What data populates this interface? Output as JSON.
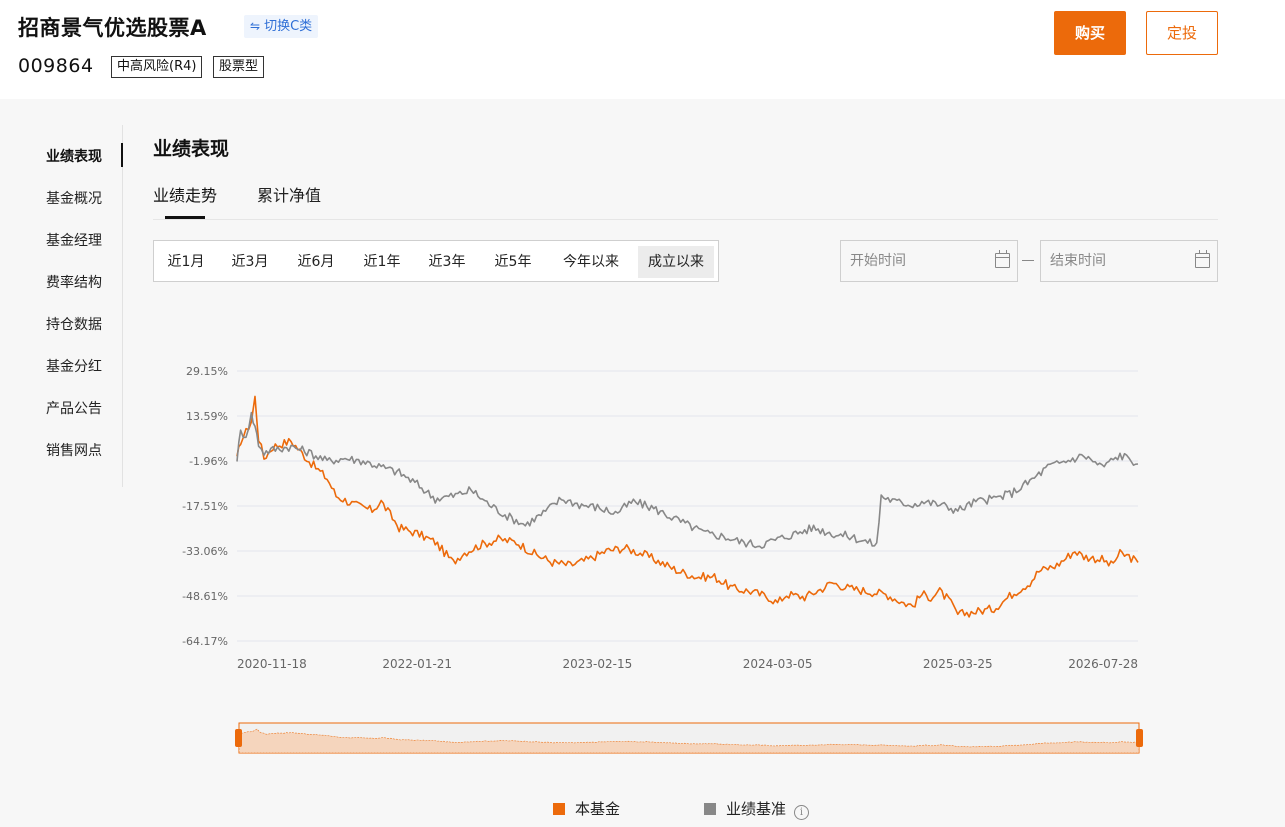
{
  "header": {
    "fund_name": "招商景气优选股票A",
    "switch_label": "切换C类",
    "fund_code": "009864",
    "tags": [
      "中高风险(R4)",
      "股票型"
    ],
    "buy_label": "购买",
    "plan_label": "定投"
  },
  "sidebar": {
    "items": [
      {
        "label": "业绩表现",
        "active": true
      },
      {
        "label": "基金概况"
      },
      {
        "label": "基金经理"
      },
      {
        "label": "费率结构"
      },
      {
        "label": "持仓数据"
      },
      {
        "label": "基金分红"
      },
      {
        "label": "产品公告"
      },
      {
        "label": "销售网点"
      }
    ]
  },
  "main": {
    "section_title": "业绩表现",
    "subtabs": [
      {
        "label": "业绩走势",
        "active": true
      },
      {
        "label": "累计净值"
      }
    ],
    "periods": [
      {
        "label": "近1月"
      },
      {
        "label": "近3月"
      },
      {
        "label": "近6月"
      },
      {
        "label": "近1年"
      },
      {
        "label": "近3年"
      },
      {
        "label": "近5年"
      },
      {
        "label": "今年以来"
      },
      {
        "label": "成立以来",
        "active": true
      }
    ],
    "start_placeholder": "开始时间",
    "end_placeholder": "结束时间"
  },
  "colors": {
    "accent": "#ec6a0b",
    "fund_line": "#ec6a0b",
    "benchmark_line": "#888888",
    "grid": "#e3e6ee"
  },
  "chart_data": {
    "type": "line",
    "y_tick_labels": [
      "29.15%",
      "13.59%",
      "-1.96%",
      "-17.51%",
      "-33.06%",
      "-48.61%",
      "-64.17%"
    ],
    "y_ticks": [
      29.15,
      13.59,
      -1.96,
      -17.51,
      -33.06,
      -48.61,
      -64.17
    ],
    "ylim": [
      -64.17,
      29.15
    ],
    "x_tick_labels": [
      "2020-11-18",
      "2022-01-21",
      "2023-02-15",
      "2024-03-05",
      "2025-03-25",
      "2026-07-28"
    ],
    "x_tick_positions": [
      0,
      0.2,
      0.4,
      0.6,
      0.8,
      1.0
    ],
    "series": [
      {
        "name": "本基金",
        "color": "#ec6a0b",
        "points": [
          [
            0,
            -1.5
          ],
          [
            0.004,
            5
          ],
          [
            0.01,
            8
          ],
          [
            0.016,
            12
          ],
          [
            0.02,
            20
          ],
          [
            0.024,
            6
          ],
          [
            0.03,
            -1
          ],
          [
            0.04,
            3
          ],
          [
            0.06,
            5
          ],
          [
            0.08,
            -2
          ],
          [
            0.1,
            -8
          ],
          [
            0.11,
            -14
          ],
          [
            0.13,
            -17
          ],
          [
            0.15,
            -19
          ],
          [
            0.16,
            -16
          ],
          [
            0.18,
            -25
          ],
          [
            0.2,
            -27
          ],
          [
            0.22,
            -30
          ],
          [
            0.24,
            -37
          ],
          [
            0.25,
            -34
          ],
          [
            0.27,
            -31
          ],
          [
            0.29,
            -29
          ],
          [
            0.31,
            -30
          ],
          [
            0.33,
            -34
          ],
          [
            0.35,
            -37
          ],
          [
            0.37,
            -38
          ],
          [
            0.39,
            -36
          ],
          [
            0.41,
            -33
          ],
          [
            0.43,
            -32
          ],
          [
            0.45,
            -34
          ],
          [
            0.47,
            -37
          ],
          [
            0.49,
            -40
          ],
          [
            0.51,
            -42
          ],
          [
            0.53,
            -42
          ],
          [
            0.55,
            -46
          ],
          [
            0.57,
            -47
          ],
          [
            0.59,
            -49
          ],
          [
            0.6,
            -51
          ],
          [
            0.61,
            -48
          ],
          [
            0.63,
            -49
          ],
          [
            0.65,
            -46
          ],
          [
            0.66,
            -44
          ],
          [
            0.68,
            -46
          ],
          [
            0.7,
            -47
          ],
          [
            0.72,
            -48
          ],
          [
            0.74,
            -51
          ],
          [
            0.75,
            -52
          ],
          [
            0.76,
            -48
          ],
          [
            0.77,
            -49
          ],
          [
            0.78,
            -47
          ],
          [
            0.79,
            -50
          ],
          [
            0.8,
            -55
          ],
          [
            0.82,
            -54
          ],
          [
            0.84,
            -53
          ],
          [
            0.86,
            -48
          ],
          [
            0.88,
            -44
          ],
          [
            0.89,
            -40
          ],
          [
            0.91,
            -38
          ],
          [
            0.93,
            -33
          ],
          [
            0.94,
            -35
          ],
          [
            0.96,
            -36
          ],
          [
            0.97,
            -38
          ],
          [
            0.98,
            -34
          ],
          [
            0.99,
            -35
          ],
          [
            1.0,
            -37
          ]
        ]
      },
      {
        "name": "业绩基准",
        "color": "#888888",
        "points": [
          [
            0,
            -1
          ],
          [
            0.004,
            8
          ],
          [
            0.01,
            7
          ],
          [
            0.016,
            14
          ],
          [
            0.02,
            10
          ],
          [
            0.024,
            4
          ],
          [
            0.03,
            1
          ],
          [
            0.04,
            2
          ],
          [
            0.06,
            3
          ],
          [
            0.08,
            1
          ],
          [
            0.1,
            -2
          ],
          [
            0.12,
            -1
          ],
          [
            0.14,
            -2
          ],
          [
            0.16,
            -4
          ],
          [
            0.18,
            -6
          ],
          [
            0.2,
            -10
          ],
          [
            0.22,
            -15
          ],
          [
            0.24,
            -14
          ],
          [
            0.26,
            -12
          ],
          [
            0.28,
            -17
          ],
          [
            0.3,
            -21
          ],
          [
            0.32,
            -24
          ],
          [
            0.34,
            -20
          ],
          [
            0.36,
            -15
          ],
          [
            0.38,
            -17
          ],
          [
            0.4,
            -18
          ],
          [
            0.42,
            -20
          ],
          [
            0.44,
            -16
          ],
          [
            0.46,
            -18
          ],
          [
            0.48,
            -21
          ],
          [
            0.5,
            -24
          ],
          [
            0.52,
            -27
          ],
          [
            0.54,
            -28
          ],
          [
            0.56,
            -30
          ],
          [
            0.58,
            -31
          ],
          [
            0.6,
            -29
          ],
          [
            0.62,
            -27
          ],
          [
            0.64,
            -25
          ],
          [
            0.66,
            -27
          ],
          [
            0.68,
            -28
          ],
          [
            0.7,
            -30
          ],
          [
            0.71,
            -31
          ],
          [
            0.715,
            -14
          ],
          [
            0.73,
            -16
          ],
          [
            0.75,
            -17
          ],
          [
            0.76,
            -16
          ],
          [
            0.78,
            -17
          ],
          [
            0.8,
            -19
          ],
          [
            0.82,
            -16
          ],
          [
            0.84,
            -15
          ],
          [
            0.86,
            -13
          ],
          [
            0.88,
            -9
          ],
          [
            0.9,
            -4
          ],
          [
            0.92,
            -2
          ],
          [
            0.94,
            0
          ],
          [
            0.96,
            -4
          ],
          [
            0.97,
            -2
          ],
          [
            0.98,
            0
          ],
          [
            0.99,
            -1
          ],
          [
            1.0,
            -3
          ]
        ]
      }
    ],
    "legend": [
      {
        "label": "本基金",
        "color": "#ec6a0b"
      },
      {
        "label": "业绩基准",
        "color": "#888888",
        "info": "i"
      }
    ],
    "grid": true,
    "legend_position": "bottom-center"
  }
}
